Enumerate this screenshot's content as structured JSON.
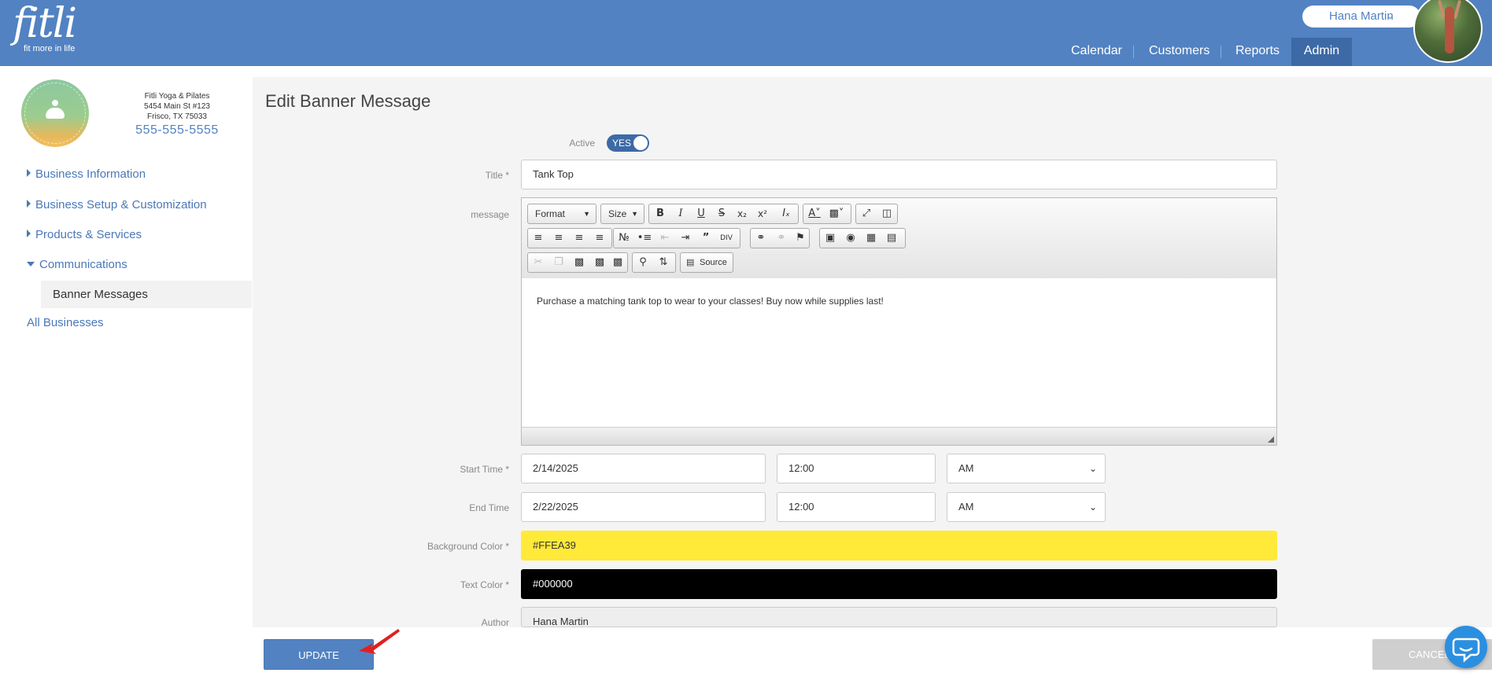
{
  "header": {
    "logo_text": "fitli",
    "logo_tagline": "fit more in life",
    "user_name": "Hana Martin",
    "user_menu_chevron": "chevron-down-icon",
    "nav": [
      {
        "label": "Calendar"
      },
      {
        "label": "Customers"
      },
      {
        "label": "Reports"
      },
      {
        "label": "Admin",
        "active": true
      }
    ]
  },
  "business": {
    "name": "Fitli Yoga & Pilates",
    "address1": "5454 Main St #123",
    "address2": "Frisco, TX 75033",
    "phone": "555-555-5555",
    "logo_text": "FITLI YOGA & PILATES"
  },
  "sidebar": {
    "items": [
      {
        "label": "Business Information",
        "expanded": false
      },
      {
        "label": "Business Setup & Customization",
        "expanded": false
      },
      {
        "label": "Products & Services",
        "expanded": false
      },
      {
        "label": "Communications",
        "expanded": true
      }
    ],
    "sub_item": "Banner Messages",
    "all_businesses": "All Businesses"
  },
  "form": {
    "page_title": "Edit Banner Message",
    "active_label": "Active",
    "active_value": "YES",
    "title_label": "Title *",
    "title_value": "Tank Top",
    "message_label": "message",
    "toolbar": {
      "format_label": "Format",
      "size_label": "Size",
      "source_label": "Source"
    },
    "message_text": "Purchase a matching tank top to wear to your classes! Buy now while supplies last!",
    "start_label": "Start Time *",
    "start_date": "2/14/2025",
    "start_time": "12:00",
    "start_ampm": "AM",
    "end_label": "End Time",
    "end_date": "2/22/2025",
    "end_time": "12:00",
    "end_ampm": "AM",
    "bg_color_label": "Background Color *",
    "bg_color_value": "#FFEA39",
    "text_color_label": "Text Color *",
    "text_color_value": "#000000",
    "author_label": "Author",
    "author_value": "Hana Martin"
  },
  "actions": {
    "update": "UPDATE",
    "cancel": "CANCEL"
  },
  "colors": {
    "brand": "#5282c2",
    "admin_tab": "#3d6aa6",
    "bg_color_swatch": "#FFEA39",
    "text_color_swatch": "#000000",
    "arrow_annotation": "#e02020",
    "chat_bubble": "#2b8fe0"
  }
}
